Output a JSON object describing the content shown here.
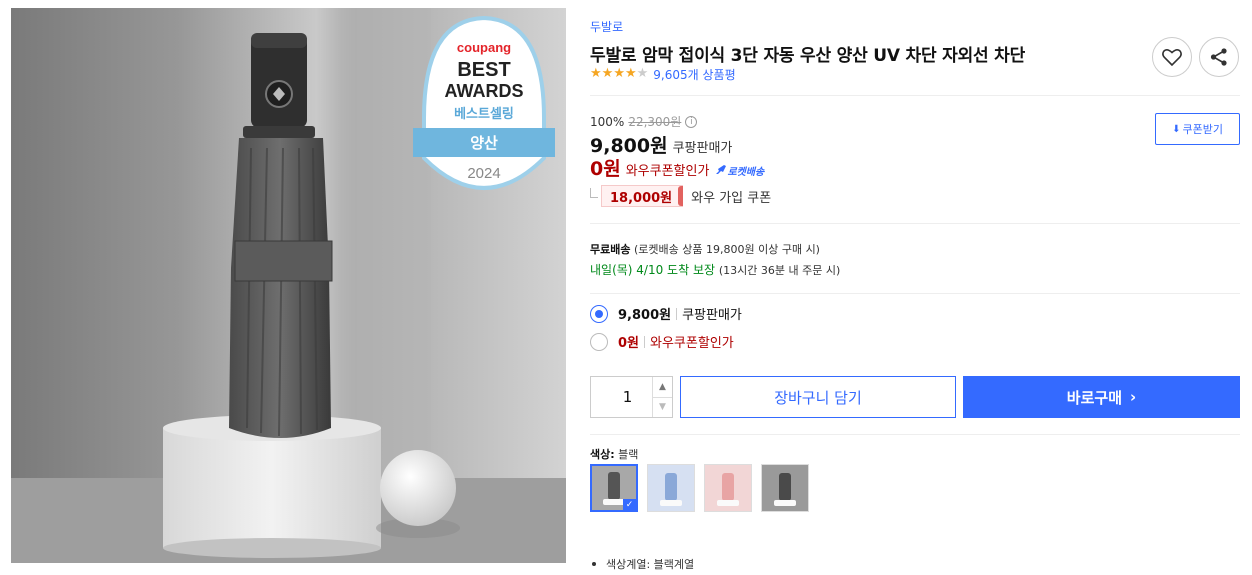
{
  "product": {
    "brand": "두발로",
    "title": "두발로 암막 접이식 3단 자동 우산 양산 UV 차단 자외선 차단",
    "rating": 4.5,
    "review_count": "9,605개 상품평"
  },
  "image": {
    "badge": {
      "brand": "coupang",
      "line1": "BEST",
      "line2": "AWARDS",
      "line3": "베스트셀링",
      "category": "양산",
      "year": "2024"
    }
  },
  "actions": {
    "wishlist_icon": "heart-icon",
    "share_icon": "share-icon"
  },
  "pricing": {
    "discount_rate": "100%",
    "original_price": "22,300원",
    "info_icon": "i",
    "sale_price": "9,800원",
    "sale_label": "쿠팡판매가",
    "wow_price": "0원",
    "wow_label": "와우쿠폰할인가",
    "rocket_label": "로켓배송",
    "coupon_amount": "18,000원",
    "coupon_text": "와우 가입 쿠폰",
    "coupon_download": "쿠폰받기"
  },
  "shipping": {
    "free_label": "무료배송",
    "free_detail": "(로켓배송 상품 19,800원 이상 구매 시)",
    "arrival": "내일(목) 4/10 도착 보장",
    "arrival_detail": "(13시간 36분 내 주문 시)"
  },
  "options": [
    {
      "price": "9,800원",
      "label": "쿠팡판매가",
      "selected": true
    },
    {
      "price": "0원",
      "label": "와우쿠폰할인가",
      "selected": false
    }
  ],
  "purchase": {
    "quantity": "1",
    "cart_label": "장바구니 담기",
    "buy_label": "바로구매"
  },
  "color": {
    "label": "색상:",
    "selected": "블랙",
    "swatches": [
      {
        "name": "블랙",
        "color": "#555555",
        "bg": "#a8a8a8"
      },
      {
        "name": "블루",
        "color": "#8aa8d8",
        "bg": "#d6e0f2"
      },
      {
        "name": "핑크",
        "color": "#e8a4a4",
        "bg": "#f2d6d6"
      },
      {
        "name": "그레이",
        "color": "#4a4a4a",
        "bg": "#9a9a9a"
      }
    ]
  },
  "specs": [
    {
      "text": "색상계열: 블랙계열"
    }
  ],
  "colors": {
    "accent": "#346aff",
    "wow_red": "#ae0000",
    "delivery_green": "#00891a"
  }
}
